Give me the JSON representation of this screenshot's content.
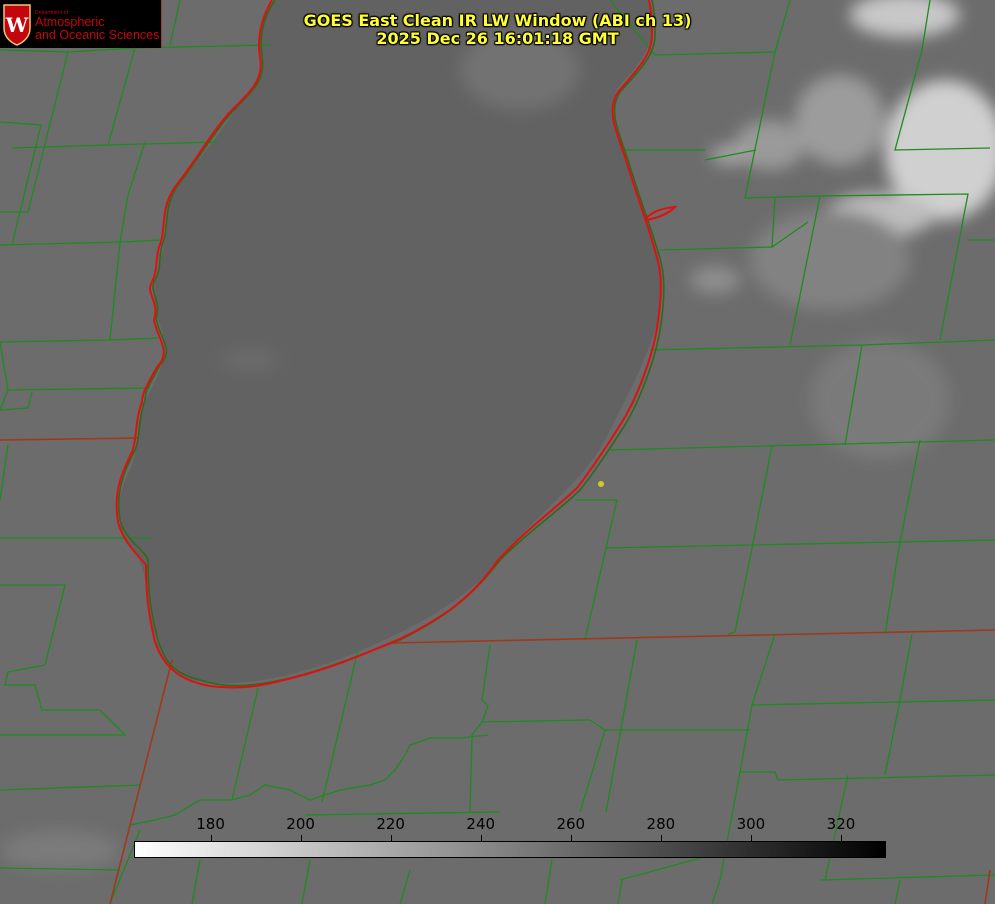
{
  "title": {
    "line1": "GOES East Clean IR LW Window (ABI ch 13)",
    "line2": "2025 Dec 26 16:01:18 GMT"
  },
  "logo": {
    "seal_letter": "W",
    "dept": "Department of",
    "line1": "Atmospheric",
    "line2": "and Oceanic Sciences"
  },
  "colorbar": {
    "min": 163,
    "max": 330,
    "ticks": [
      "180",
      "200",
      "220",
      "240",
      "260",
      "280",
      "300",
      "320"
    ],
    "gradient": "white to black (brightness temperature, K)"
  },
  "colors": {
    "background": "#6e6e6e",
    "county_lines": "#1f8a1f",
    "state_lines": "#a0391a",
    "shoreline_red": "#e01010",
    "title_text": "#ffff33",
    "marker": "#d6c81e",
    "logo_red": "#c5050c"
  },
  "marker": {
    "name": "location-dot"
  }
}
